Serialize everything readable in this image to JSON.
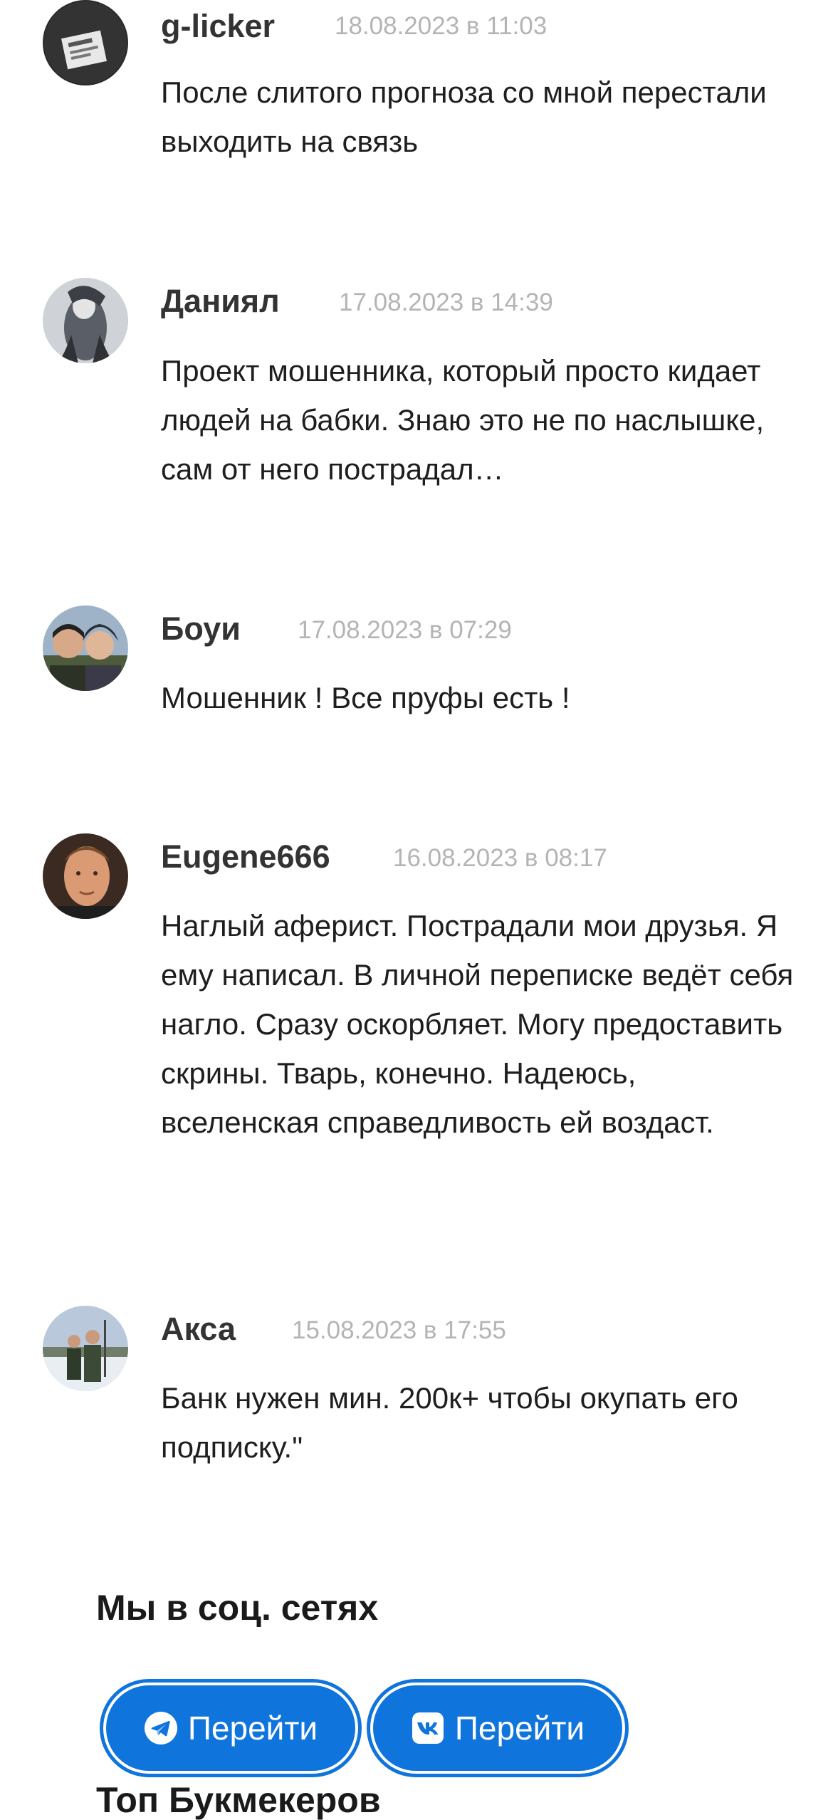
{
  "comments": [
    {
      "author": "g-licker",
      "date": "18.08.2023 в 11:03",
      "text": "После слитого прогноза со мной перестали выходить на связь"
    },
    {
      "author": "Даниял",
      "date": "17.08.2023 в 14:39",
      "text": "Проект мошенника, который просто кидает людей на бабки. Знаю это не по наслышке, сам от него пострадал…"
    },
    {
      "author": "Боуи",
      "date": "17.08.2023 в 07:29",
      "text": "Мошенник ! Все пруфы есть !"
    },
    {
      "author": "Eugene666",
      "date": "16.08.2023 в 08:17",
      "text": "Наглый аферист. Пострадали мои друзья. Я ему написал. В личной переписке ведёт себя нагло. Сразу оскорбляет. Могу предоставить скрины. Тварь, конечно. Надеюсь, вселенская справедливость ей воздаст."
    },
    {
      "author": "Акса",
      "date": "15.08.2023 в 17:55",
      "text": "Банк нужен мин. 200к+ чтобы окупать его подписку.\""
    }
  ],
  "social": {
    "title": "Мы в соц. сетях",
    "buttons": [
      {
        "icon": "telegram-icon",
        "label": "Перейти"
      },
      {
        "icon": "vk-icon",
        "label": "Перейти"
      }
    ]
  },
  "next_section": {
    "title": "Топ Букмекеров"
  },
  "colors": {
    "accent": "#0f74dc",
    "date": "#b4b4b4",
    "text": "#1e1e1e"
  }
}
